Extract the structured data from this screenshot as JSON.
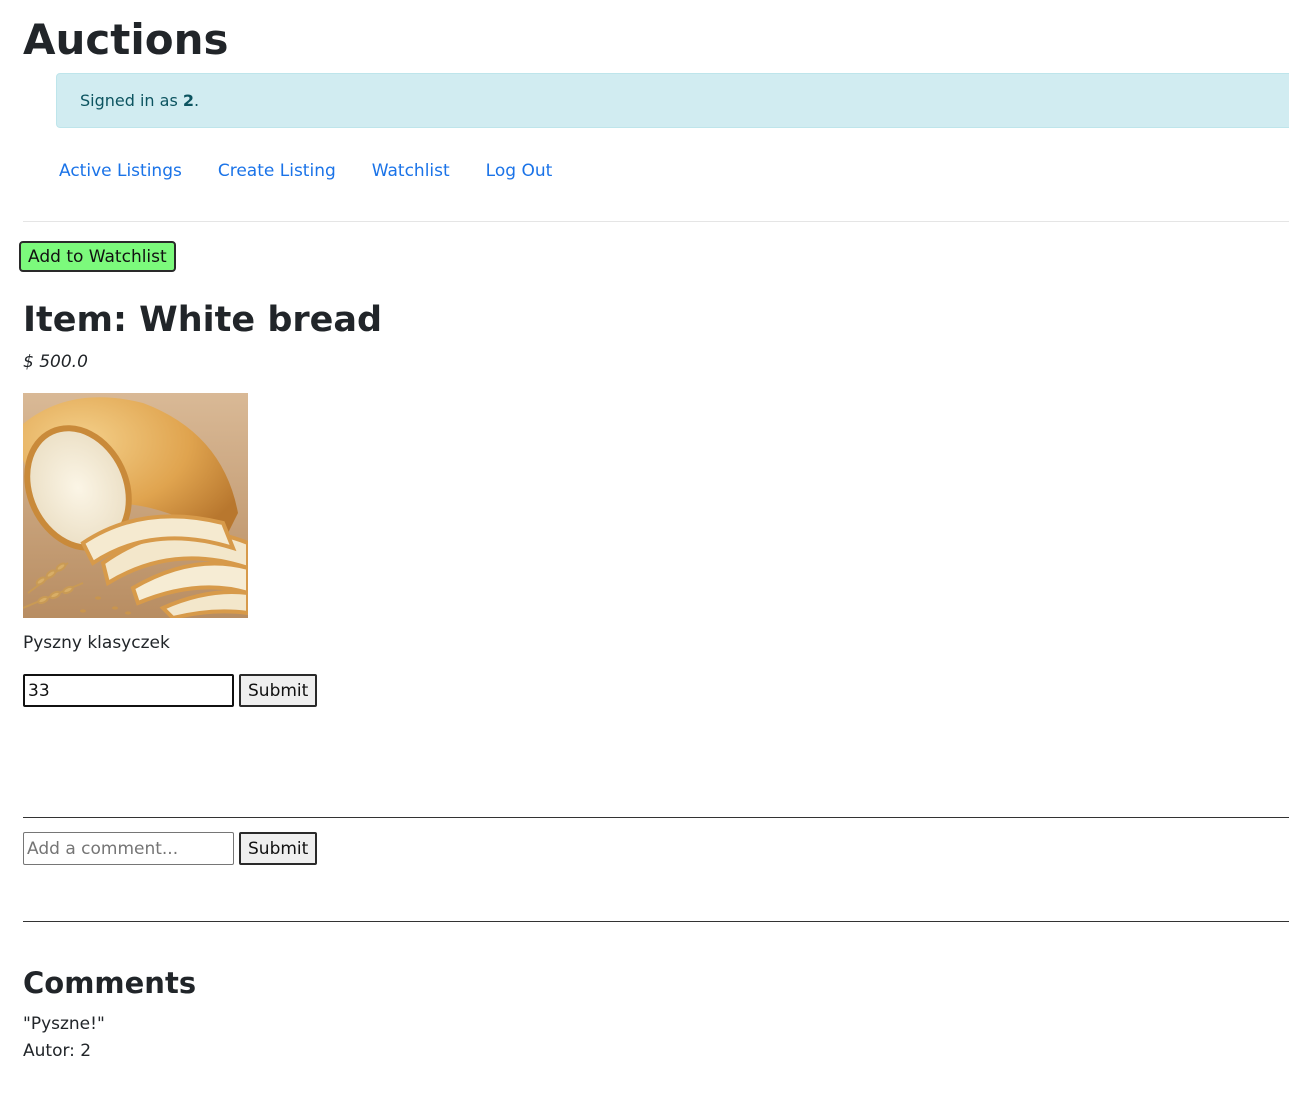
{
  "header": {
    "title": "Auctions"
  },
  "alert": {
    "prefix": "Signed in as ",
    "username": "2",
    "suffix": "."
  },
  "nav": {
    "items": [
      {
        "label": "Active Listings"
      },
      {
        "label": "Create Listing"
      },
      {
        "label": "Watchlist"
      },
      {
        "label": "Log Out"
      }
    ]
  },
  "listing": {
    "watchlist_button": "Add to Watchlist",
    "title": "Item: White bread",
    "price": "$ 500.0",
    "image_icon": "bread-image",
    "description": "Pyszny klasyczek"
  },
  "bid_form": {
    "value": "33",
    "submit_label": "Submit"
  },
  "comment_form": {
    "placeholder": "Add a comment...",
    "value": "",
    "submit_label": "Submit"
  },
  "comments": {
    "title": "Comments",
    "items": [
      {
        "text": "\"Pyszne!\"",
        "author": "Autor: 2"
      }
    ]
  },
  "colors": {
    "link": "#1a73e8",
    "alert_bg": "#d1ecf1",
    "alert_text": "#0c5460",
    "watch_button_bg": "#7cfa7c"
  }
}
